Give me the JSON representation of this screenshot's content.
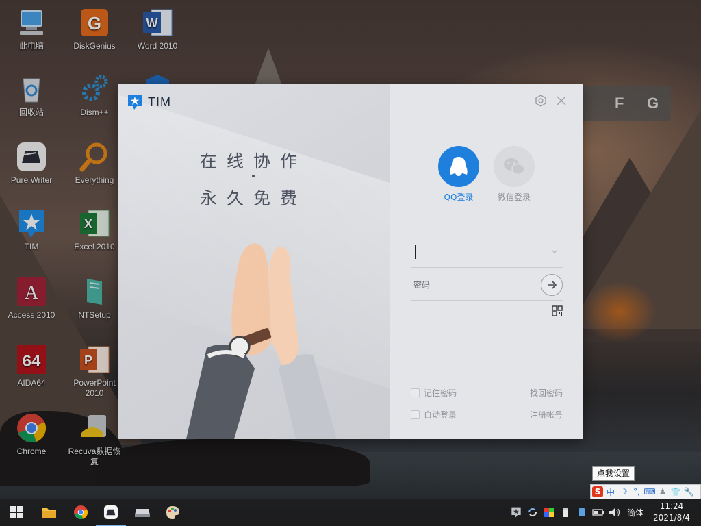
{
  "desktop": {
    "icons": [
      {
        "name": "this-pc",
        "label": "此电脑"
      },
      {
        "name": "diskgenius",
        "label": "DiskGenius"
      },
      {
        "name": "word-2010",
        "label": "Word 2010"
      },
      {
        "name": "recycle-bin",
        "label": "回收站"
      },
      {
        "name": "dism",
        "label": "Dism++"
      },
      {
        "name": "pure-writer",
        "label": "Pure Writer"
      },
      {
        "name": "everything",
        "label": "Everything"
      },
      {
        "name": "tim",
        "label": "TIM"
      },
      {
        "name": "excel-2010",
        "label": "Excel 2010"
      },
      {
        "name": "access-2010",
        "label": "Access 2010"
      },
      {
        "name": "ntsetup",
        "label": "NTSetup"
      },
      {
        "name": "aida64",
        "label": "AIDA64"
      },
      {
        "name": "powerpoint-2010",
        "label": "PowerPoint 2010"
      },
      {
        "name": "chrome",
        "label": "Chrome"
      },
      {
        "name": "recuva",
        "label": "Recuva数据恢复"
      }
    ],
    "launcher_letters": [
      "F",
      "G"
    ]
  },
  "tim_window": {
    "logo_text": "TIM",
    "slogan_line1": "在线协作",
    "slogan_line2": "永久免费",
    "tabs": {
      "qq_label": "QQ登录",
      "wechat_label": "微信登录"
    },
    "account_value": "",
    "password_placeholder": "密码",
    "remember_password": "记住密码",
    "auto_login": "自动登录",
    "find_password": "找回密码",
    "register": "注册帐号",
    "colors": {
      "accent": "#1f7fdd"
    }
  },
  "ime": {
    "tooltip": "点我设置",
    "mode_char": "中"
  },
  "taskbar": {
    "lang": "简体",
    "time": "11:24",
    "date": "2021/8/4"
  }
}
